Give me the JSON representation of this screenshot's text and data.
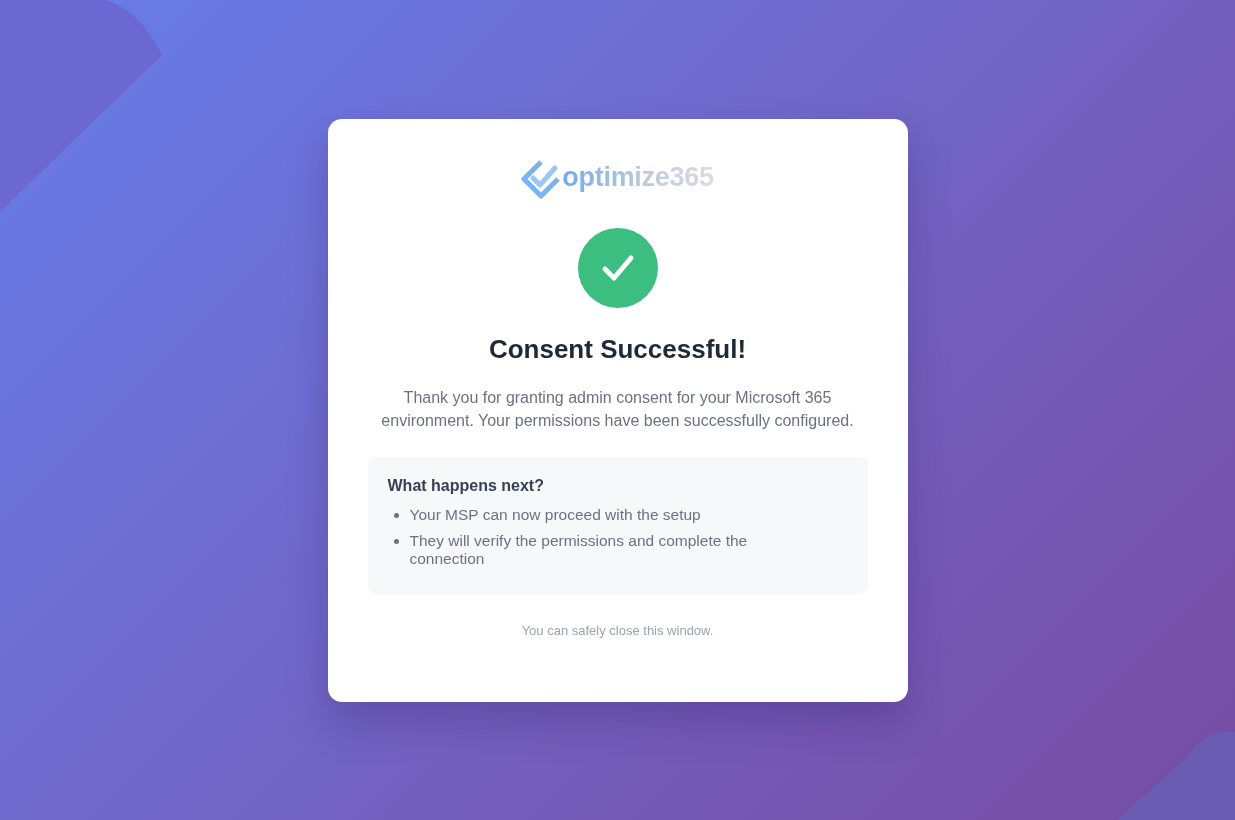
{
  "logo": {
    "text": "optimize365"
  },
  "title": "Consent Successful!",
  "message": "Thank you for granting admin consent for your Microsoft 365 environment. Your permissions have been successfully configured.",
  "next_steps": {
    "heading": "What happens next?",
    "items": [
      "Your MSP can now proceed with the setup",
      "They will verify the permissions and complete the connection"
    ]
  },
  "footer": "You can safely close this window."
}
